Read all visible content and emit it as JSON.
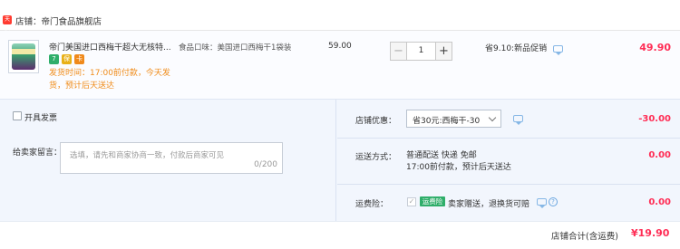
{
  "shop": {
    "label": "店铺：帝门食品旗舰店",
    "icon_text": "天猫"
  },
  "item": {
    "title": "帝门美国进口西梅干超大无核特...",
    "badges": [
      "7",
      "保",
      "卡"
    ],
    "ship_time_line1": "发货时间：17:00前付款，今天发",
    "ship_time_line2": "货，预计后天送达",
    "attribute": "食品口味：美国进口西梅干1袋装",
    "unit_price": "59.00",
    "quantity": "1",
    "minus": "−",
    "plus": "+",
    "promotion": "省9.10:新品促销",
    "total": "49.90"
  },
  "invoice": {
    "label": "开具发票"
  },
  "message": {
    "label": "给卖家留言：",
    "placeholder": "选填，请先和商家协商一致，付款后商家可见",
    "counter": "0/200"
  },
  "coupon": {
    "label": "店铺优惠：",
    "selected": "省30元:西梅干-30",
    "value": "-30.00"
  },
  "shipping": {
    "label": "运送方式：",
    "line1": "普通配送 快递 免邮",
    "line2": "17:00前付款，预计后天送达",
    "value": "0.00"
  },
  "insurance": {
    "label": "运费险：",
    "tag": "运费险",
    "text": "卖家赠送，退换货可赔",
    "help": "?",
    "value": "0.00"
  },
  "footer": {
    "label": "店铺合计(含运费)",
    "total": "¥19.90"
  },
  "colors": {
    "price_red": "#ff2d55",
    "ship_orange": "#f08c1a",
    "accent_green": "#2fae6a"
  }
}
